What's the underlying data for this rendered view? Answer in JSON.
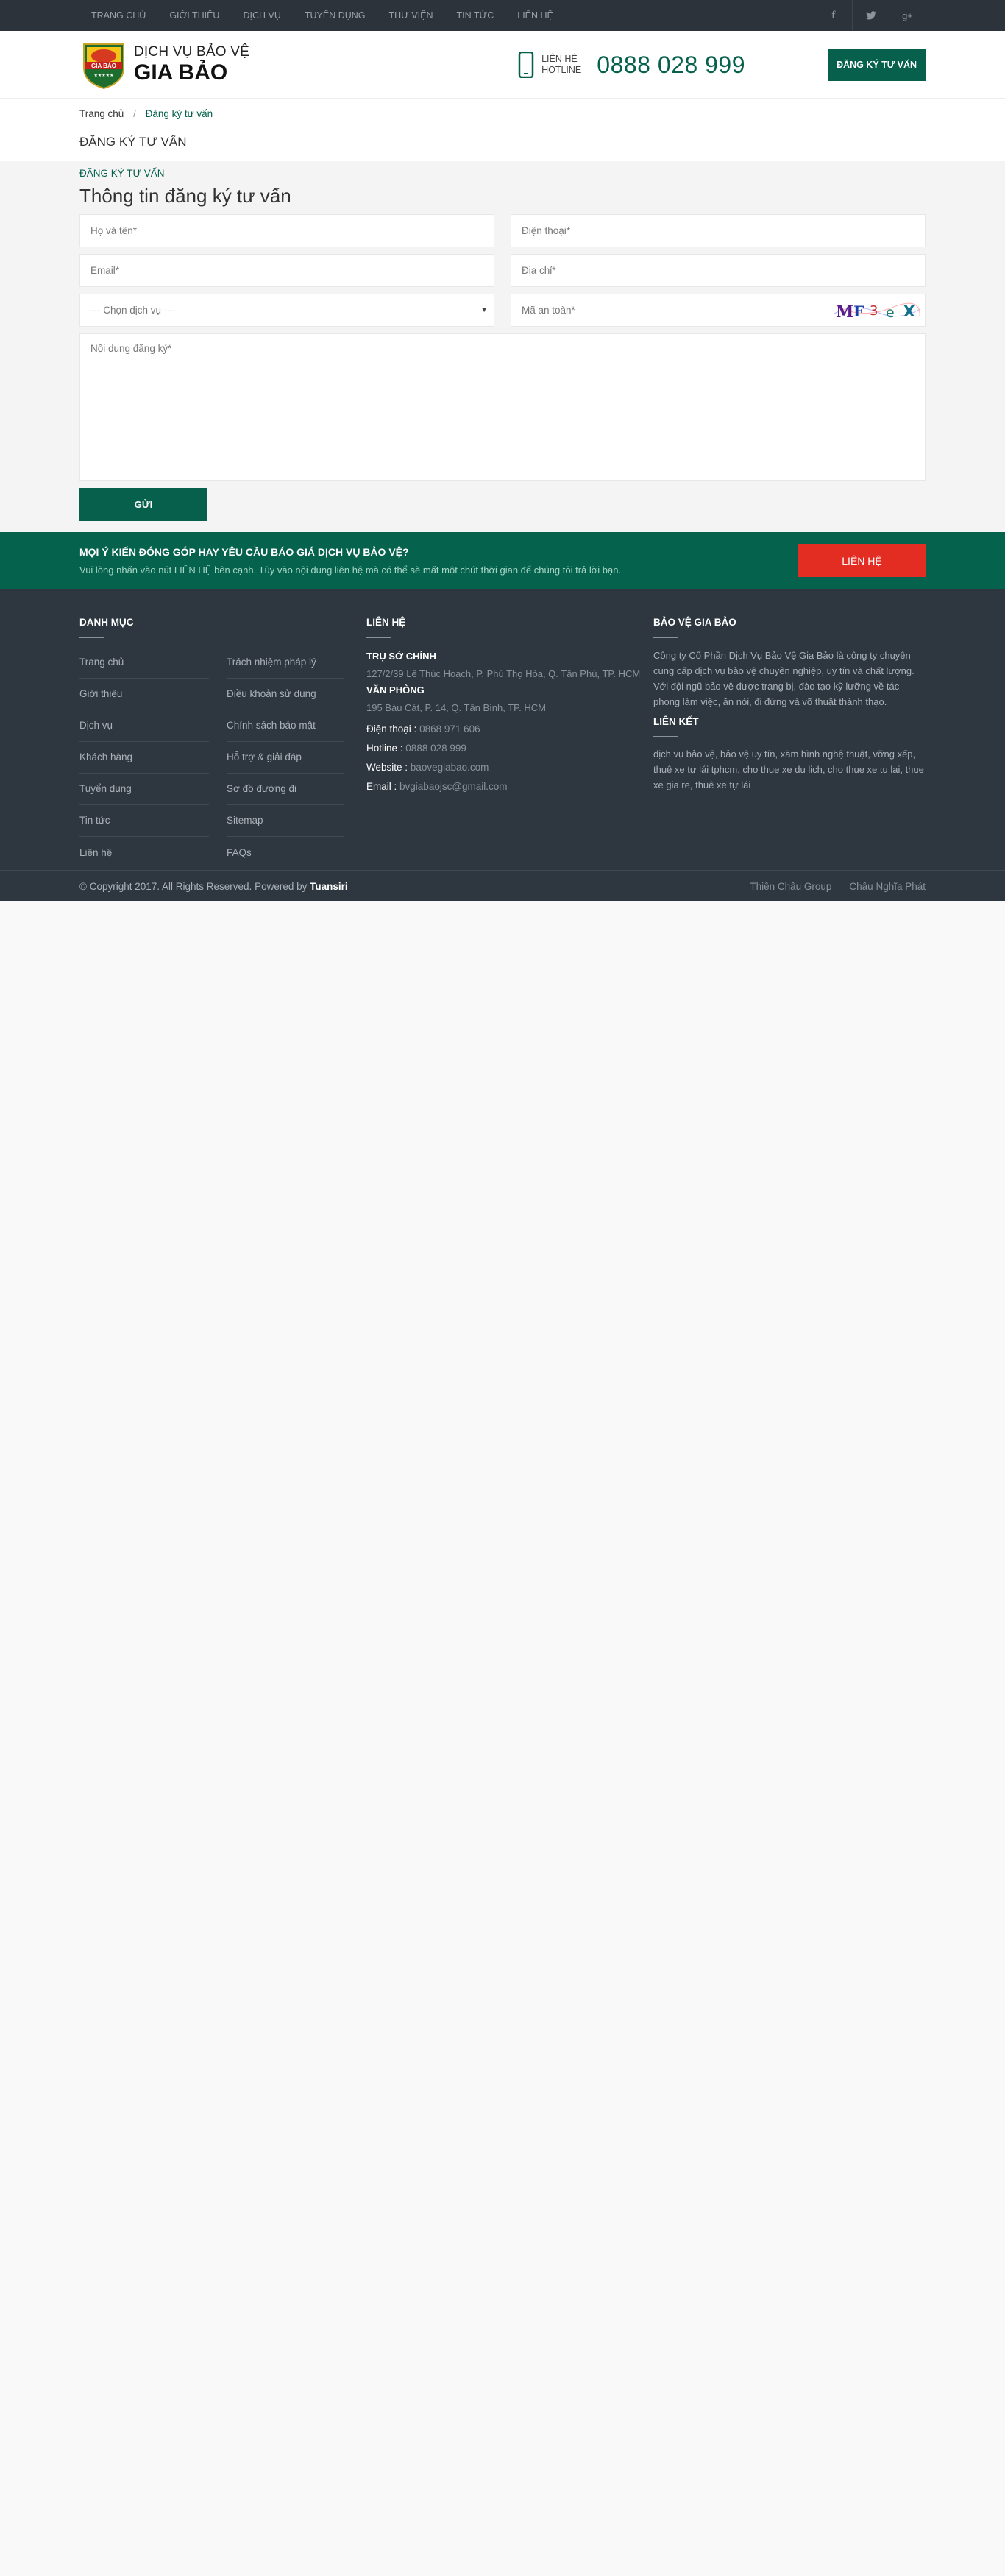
{
  "topnav": {
    "items": [
      "TRANG CHỦ",
      "GIỚI THIỆU",
      "DỊCH VỤ",
      "TUYỂN DỤNG",
      "THƯ VIỆN",
      "TIN TỨC",
      "LIÊN HỆ"
    ],
    "social": [
      "facebook-icon",
      "twitter-icon",
      "google-plus-icon"
    ],
    "bg": "#2c333b"
  },
  "header": {
    "logo_line1": "DỊCH VỤ BẢO VỆ",
    "logo_line2": "GIA BẢO",
    "logo_badge": "GIA BẢO",
    "hotline_label1": "LIÊN HỆ",
    "hotline_label2": "HOTLINE",
    "hotline_number": "0888 028 999",
    "register_button": "ĐĂNG KÝ TƯ VẤN",
    "accent": "#06604c"
  },
  "breadcrumb": {
    "home": "Trang chủ",
    "sep": "/",
    "current": "Đăng ký tư vấn"
  },
  "page_heading": "ĐĂNG KÝ TƯ VẤN",
  "form": {
    "tag": "ĐĂNG KÝ TƯ VẤN",
    "title": "Thông tin đăng ký tư vấn",
    "name_placeholder": "Họ và tên*",
    "phone_placeholder": "Điện thoại*",
    "email_placeholder": "Email*",
    "address_placeholder": "Địa chỉ*",
    "service_selected": "--- Chọn dịch vụ ---",
    "captcha_placeholder": "Mã an toàn*",
    "captcha_text": "MF3eX",
    "message_placeholder": "Nội dung đăng ký*",
    "submit_label": "GỬI"
  },
  "cta": {
    "question": "MỌI Ý KIẾN ĐÓNG GÓP HAY YÊU CẦU BÁO GIÁ DỊCH VỤ BẢO VỆ?",
    "subtext": "Vui lòng nhấn vào nút LIÊN HỆ bên cạnh. Tùy vào nội dung liên hệ mà có thể sẽ mất một chút thời gian để chúng tôi trả lời bạn.",
    "button": "LIÊN HỆ",
    "bg": "#05624d",
    "button_color": "#e32d22"
  },
  "footer": {
    "categories_heading": "DANH MỤC",
    "links": [
      "Trang chủ",
      "Trách nhiệm pháp lý",
      "Giới thiệu",
      "Điều khoản sử dụng",
      "Dịch vụ",
      "Chính sách bảo mật",
      "Khách hàng",
      "Hỗ trợ & giải đáp",
      "Tuyển dụng",
      "Sơ đồ đường đi",
      "Tin tức",
      "Sitemap",
      "Liên hệ",
      "FAQs"
    ],
    "contact_heading": "LIÊN HỆ",
    "hq_heading": "TRỤ SỞ CHÍNH",
    "hq_address": "127/2/39 Lê Thúc Hoạch, P. Phú Thọ Hòa, Q. Tân Phú, TP. HCM",
    "office_heading": "VĂN PHÒNG",
    "office_address": "195 Bàu Cát, P. 14, Q. Tân Bình, TP. HCM",
    "phone_label": "Điện thoại :",
    "phone_value": "0868 971 606",
    "hotline_label": "Hotline :",
    "hotline_value": "0888 028 999",
    "website_label": "Website :",
    "website_value": "baovegiabao.com",
    "email_label": "Email :",
    "email_value": "bvgiabaojsc@gmail.com",
    "about_heading": "BẢO VỆ GIA BẢO",
    "about_text": "Công ty Cổ Phần Dịch Vụ Bảo Vệ Gia Bảo là công ty chuyên cung cấp dịch vụ bảo vệ chuyên nghiệp, uy tín và chất lượng. Với đội ngũ bảo vệ được trang bị, đào tạo kỹ lưỡng về tác phong làm việc, ăn nói, đi đứng và võ thuật thành thạo.",
    "links_heading": "LIÊN KẾT",
    "tags_text": "dịch vụ bảo vệ, bảo vệ uy tín, xăm hình nghệ thuật, vỡng xếp, thuê xe tự lái tphcm, cho thue xe du lich, cho thue xe tu lai, thue xe gia re, thuê xe tự lái",
    "copyright": "© Copyright 2017. All Rights Reserved. Powered by",
    "powered_by": "Tuansiri",
    "partner1": "Thiên Châu Group",
    "partner2": "Châu Nghĩa Phát"
  }
}
